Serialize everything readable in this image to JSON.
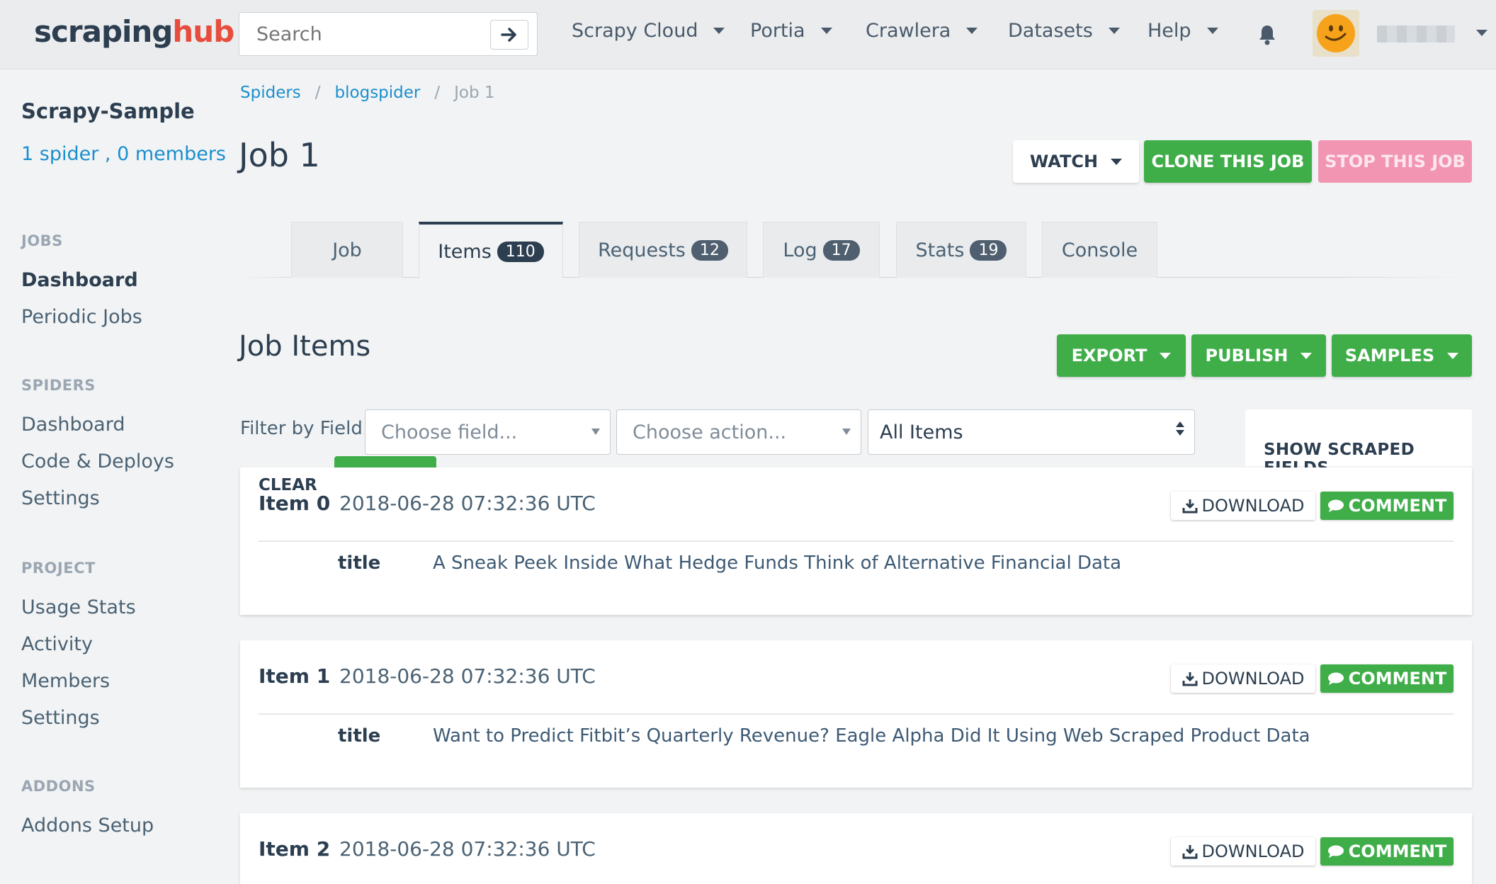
{
  "brand": {
    "logo_main": "scraping",
    "logo_accent": "hub"
  },
  "search": {
    "placeholder": "Search"
  },
  "nav": [
    {
      "label": "Scrapy Cloud"
    },
    {
      "label": "Portia"
    },
    {
      "label": "Crawlera"
    },
    {
      "label": "Datasets"
    },
    {
      "label": "Help"
    }
  ],
  "sidebar": {
    "project_name": "Scrapy-Sample",
    "spider_count": "1 spider",
    "member_sep": ",",
    "member_count": "0 members",
    "sections": [
      {
        "heading": "JOBS",
        "items": [
          "Dashboard",
          "Periodic Jobs"
        ]
      },
      {
        "heading": "SPIDERS",
        "items": [
          "Dashboard",
          "Code & Deploys",
          "Settings"
        ]
      },
      {
        "heading": "PROJECT",
        "items": [
          "Usage Stats",
          "Activity",
          "Members",
          "Settings"
        ]
      },
      {
        "heading": "ADDONS",
        "items": [
          "Addons Setup"
        ]
      }
    ]
  },
  "breadcrumb": {
    "sep": "/",
    "items": [
      "Spiders",
      "blogspider",
      "Job 1"
    ]
  },
  "page": {
    "title": "Job 1"
  },
  "job_actions": {
    "watch": "WATCH",
    "clone": "CLONE THIS JOB",
    "stop": "STOP THIS JOB"
  },
  "tabs": [
    {
      "label": "Job",
      "count": ""
    },
    {
      "label": "Items",
      "count": "110"
    },
    {
      "label": "Requests",
      "count": "12"
    },
    {
      "label": "Log",
      "count": "17"
    },
    {
      "label": "Stats",
      "count": "19"
    },
    {
      "label": "Console",
      "count": ""
    }
  ],
  "items_section": {
    "title": "Job Items",
    "export": "EXPORT",
    "publish": "PUBLISH",
    "samples": "SAMPLES"
  },
  "filter": {
    "label": "Filter by Field:",
    "field_placeholder": "Choose field...",
    "action_placeholder": "Choose action...",
    "scope_value": "All Items",
    "clear": "CLEAR",
    "show_scraped": "SHOW SCRAPED FIELDS"
  },
  "item_buttons": {
    "download": "DOWNLOAD",
    "comment": "COMMENT"
  },
  "items": [
    {
      "label": "Item 0",
      "time": "2018-06-28 07:32:36 UTC",
      "field": "title",
      "value": "A Sneak Peek Inside What Hedge Funds Think of Alternative Financial Data"
    },
    {
      "label": "Item 1",
      "time": "2018-06-28 07:32:36 UTC",
      "field": "title",
      "value": "Want to Predict Fitbit’s Quarterly Revenue? Eagle Alpha Did It Using Web Scraped Product Data"
    },
    {
      "label": "Item 2",
      "time": "2018-06-28 07:32:36 UTC"
    }
  ],
  "colors": {
    "accent_green": "#3fae49",
    "link_blue": "#1b8fce",
    "stop_pink": "#f195b3",
    "brand_red": "#e74c3c"
  }
}
